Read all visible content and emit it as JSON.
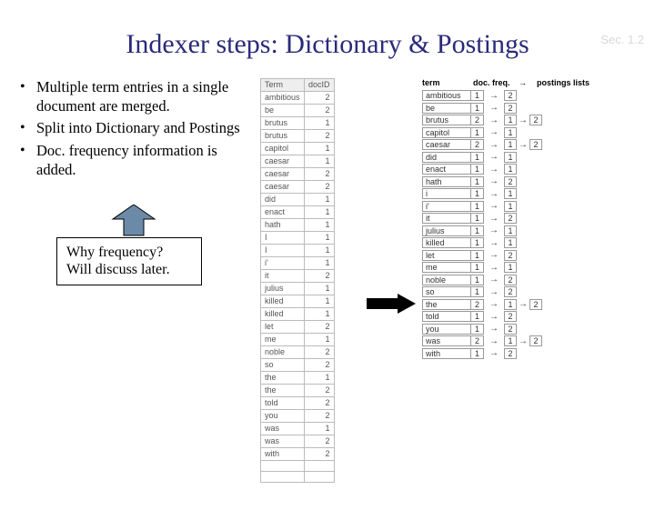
{
  "section_tag": "Sec. 1.2",
  "title": "Indexer steps: Dictionary & Postings",
  "bullets": [
    "Multiple term entries in a single document are merged.",
    "Split into Dictionary and Postings",
    "Doc. frequency information is added."
  ],
  "callout": {
    "line1": "Why frequency?",
    "line2": "Will discuss later."
  },
  "table1": {
    "headers": [
      "Term",
      "docID"
    ],
    "rows": [
      [
        "ambitious",
        "2"
      ],
      [
        "be",
        "2"
      ],
      [
        "brutus",
        "1"
      ],
      [
        "brutus",
        "2"
      ],
      [
        "capitol",
        "1"
      ],
      [
        "caesar",
        "1"
      ],
      [
        "caesar",
        "2"
      ],
      [
        "caesar",
        "2"
      ],
      [
        "did",
        "1"
      ],
      [
        "enact",
        "1"
      ],
      [
        "hath",
        "1"
      ],
      [
        "I",
        "1"
      ],
      [
        "I",
        "1"
      ],
      [
        "i'",
        "1"
      ],
      [
        "it",
        "2"
      ],
      [
        "julius",
        "1"
      ],
      [
        "killed",
        "1"
      ],
      [
        "killed",
        "1"
      ],
      [
        "let",
        "2"
      ],
      [
        "me",
        "1"
      ],
      [
        "noble",
        "2"
      ],
      [
        "so",
        "2"
      ],
      [
        "the",
        "1"
      ],
      [
        "the",
        "2"
      ],
      [
        "told",
        "2"
      ],
      [
        "you",
        "2"
      ],
      [
        "was",
        "1"
      ],
      [
        "was",
        "2"
      ],
      [
        "with",
        "2"
      ],
      [
        "",
        ""
      ],
      [
        "",
        ""
      ]
    ]
  },
  "postings_header": {
    "term": "term",
    "df": "doc. freq.",
    "arrow": "→",
    "lists": "postings lists"
  },
  "postings": [
    {
      "term": "ambitious",
      "df": "1",
      "list": [
        "2"
      ]
    },
    {
      "term": "be",
      "df": "1",
      "list": [
        "2"
      ]
    },
    {
      "term": "brutus",
      "df": "2",
      "list": [
        "1",
        "2"
      ]
    },
    {
      "term": "capitol",
      "df": "1",
      "list": [
        "1"
      ]
    },
    {
      "term": "caesar",
      "df": "2",
      "list": [
        "1",
        "2"
      ]
    },
    {
      "term": "did",
      "df": "1",
      "list": [
        "1"
      ]
    },
    {
      "term": "enact",
      "df": "1",
      "list": [
        "1"
      ]
    },
    {
      "term": "hath",
      "df": "1",
      "list": [
        "2"
      ]
    },
    {
      "term": "i",
      "df": "1",
      "list": [
        "1"
      ]
    },
    {
      "term": "i'",
      "df": "1",
      "list": [
        "1"
      ]
    },
    {
      "term": "it",
      "df": "1",
      "list": [
        "2"
      ]
    },
    {
      "term": "julius",
      "df": "1",
      "list": [
        "1"
      ]
    },
    {
      "term": "killed",
      "df": "1",
      "list": [
        "1"
      ]
    },
    {
      "term": "let",
      "df": "1",
      "list": [
        "2"
      ]
    },
    {
      "term": "me",
      "df": "1",
      "list": [
        "1"
      ]
    },
    {
      "term": "noble",
      "df": "1",
      "list": [
        "2"
      ]
    },
    {
      "term": "so",
      "df": "1",
      "list": [
        "2"
      ]
    },
    {
      "term": "the",
      "df": "2",
      "list": [
        "1",
        "2"
      ]
    },
    {
      "term": "told",
      "df": "1",
      "list": [
        "2"
      ]
    },
    {
      "term": "you",
      "df": "1",
      "list": [
        "2"
      ]
    },
    {
      "term": "was",
      "df": "2",
      "list": [
        "1",
        "2"
      ]
    },
    {
      "term": "with",
      "df": "1",
      "list": [
        "2"
      ]
    }
  ]
}
